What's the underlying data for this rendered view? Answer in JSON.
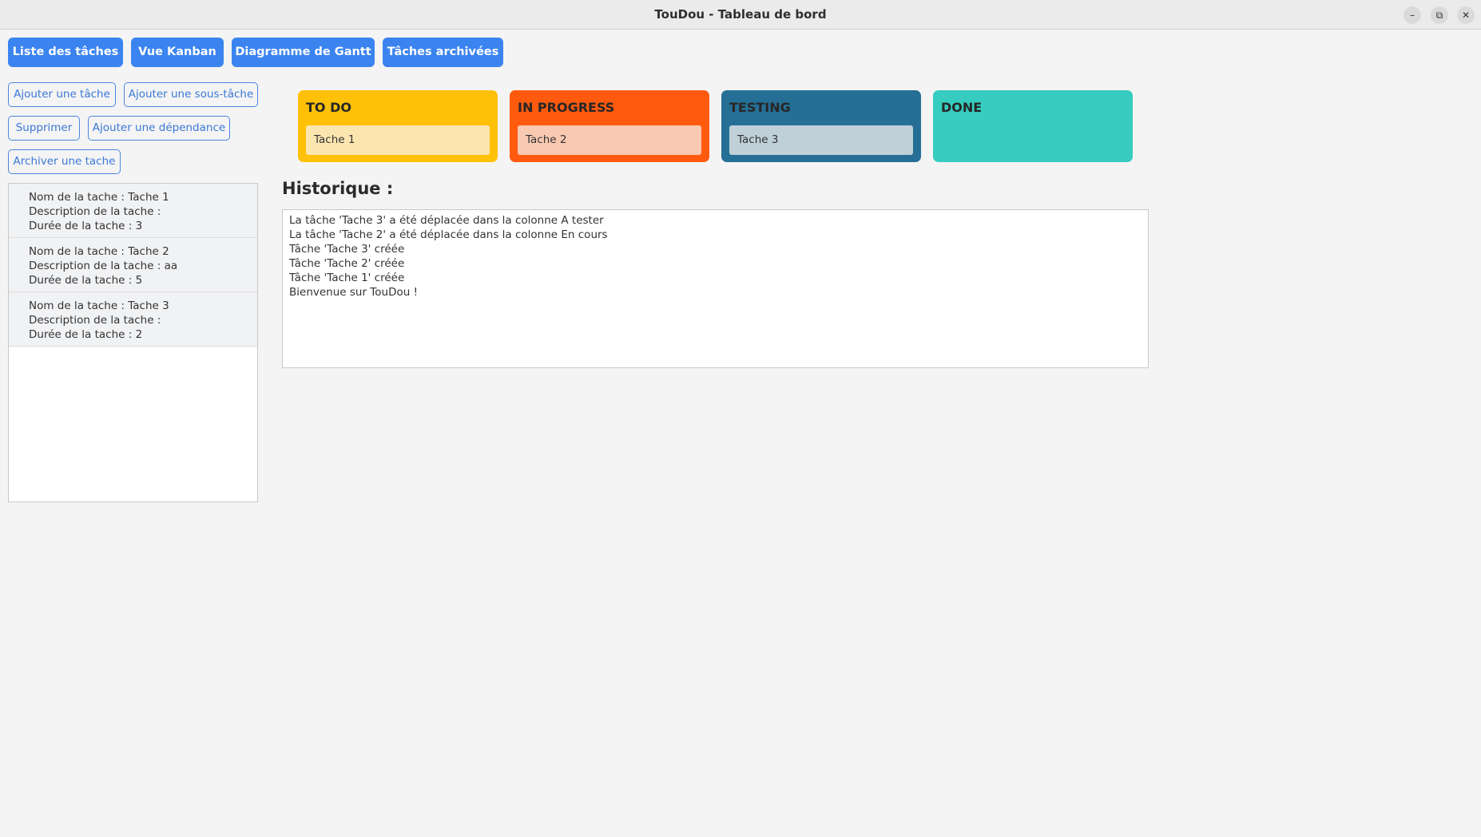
{
  "window": {
    "title": "TouDou - Tableau de bord",
    "minimize_glyph": "–",
    "restore_glyph": "⧉",
    "close_glyph": "✕"
  },
  "nav": {
    "tasks": "Liste des tâches",
    "kanban": "Vue Kanban",
    "gantt": "Diagramme de Gantt",
    "archived": "Tâches archivées"
  },
  "actions": {
    "add_task": "Ajouter une tâche",
    "add_subtask": "Ajouter une sous-tâche",
    "delete": "Supprimer",
    "add_dependency": "Ajouter une dépendance",
    "archive": "Archiver une tache"
  },
  "tasks": [
    {
      "name": "Nom de la tache : Tache 1",
      "description": "Description de la  tache :",
      "duration": "Durée de la tache : 3"
    },
    {
      "name": "Nom de la tache : Tache 2",
      "description": "Description de la  tache : aa",
      "duration": "Durée de la tache : 5"
    },
    {
      "name": "Nom de la tache : Tache 3",
      "description": "Description de la  tache :",
      "duration": "Durée de la tache : 2"
    }
  ],
  "kanban": {
    "columns": [
      {
        "title": "TO DO",
        "card": "Tache 1",
        "color": "#ffc107",
        "card_color": "#fbe6b0"
      },
      {
        "title": "IN PROGRESS",
        "card": "Tache 2",
        "color": "#ff5a0e",
        "card_color": "#f9c9b2"
      },
      {
        "title": "TESTING",
        "card": "Tache 3",
        "color": "#256f96",
        "card_color": "#bfd0d9"
      },
      {
        "title": "DONE",
        "card": null,
        "color": "#36ccbf"
      }
    ]
  },
  "history": {
    "title": "Historique :",
    "lines": [
      "La tâche 'Tache 3' a été déplacée dans la colonne A tester",
      "La tâche 'Tache 2' a été déplacée dans la colonne En cours",
      "Tâche 'Tache 3' créée",
      "Tâche 'Tache 2' créée",
      "Tâche 'Tache 1' créée",
      "Bienvenue sur TouDou !"
    ]
  }
}
